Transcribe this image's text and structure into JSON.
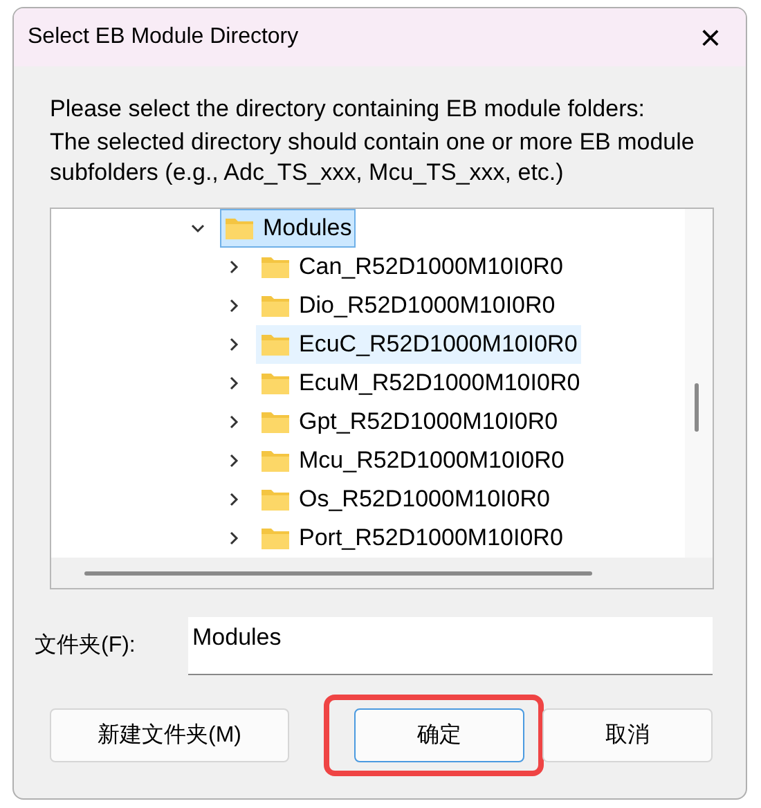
{
  "window": {
    "title": "Select EB Module Directory",
    "close": "×"
  },
  "instructions": [
    "Please select the directory containing EB module folders:",
    "The selected directory should contain one or more EB module subfolders (e.g., Adc_TS_xxx, Mcu_TS_xxx, etc.)"
  ],
  "tree": [
    {
      "label": "Modules",
      "expanded": true,
      "selected": true,
      "hovered": false,
      "children": [
        {
          "label": "Can_R52D1000M10I0R0",
          "expanded": false,
          "selected": false,
          "hovered": false
        },
        {
          "label": "Dio_R52D1000M10I0R0",
          "expanded": false,
          "selected": false,
          "hovered": false
        },
        {
          "label": "EcuC_R52D1000M10I0R0",
          "expanded": false,
          "selected": false,
          "hovered": true
        },
        {
          "label": "EcuM_R52D1000M10I0R0",
          "expanded": false,
          "selected": false,
          "hovered": false
        },
        {
          "label": "Gpt_R52D1000M10I0R0",
          "expanded": false,
          "selected": false,
          "hovered": false
        },
        {
          "label": "Mcu_R52D1000M10I0R0",
          "expanded": false,
          "selected": false,
          "hovered": false
        },
        {
          "label": "Os_R52D1000M10I0R0",
          "expanded": false,
          "selected": false,
          "hovered": false
        },
        {
          "label": "Port_R52D1000M10I0R0",
          "expanded": false,
          "selected": false,
          "hovered": false
        }
      ]
    }
  ],
  "folder_field": {
    "label": "文件夹(F):",
    "value": "Modules"
  },
  "buttons": [
    {
      "label": "新建文件夹(M)",
      "focused": false,
      "highlighted": false
    },
    {
      "label": "确定",
      "focused": true,
      "highlighted": true
    },
    {
      "label": "取消",
      "focused": false,
      "highlighted": false
    }
  ]
}
